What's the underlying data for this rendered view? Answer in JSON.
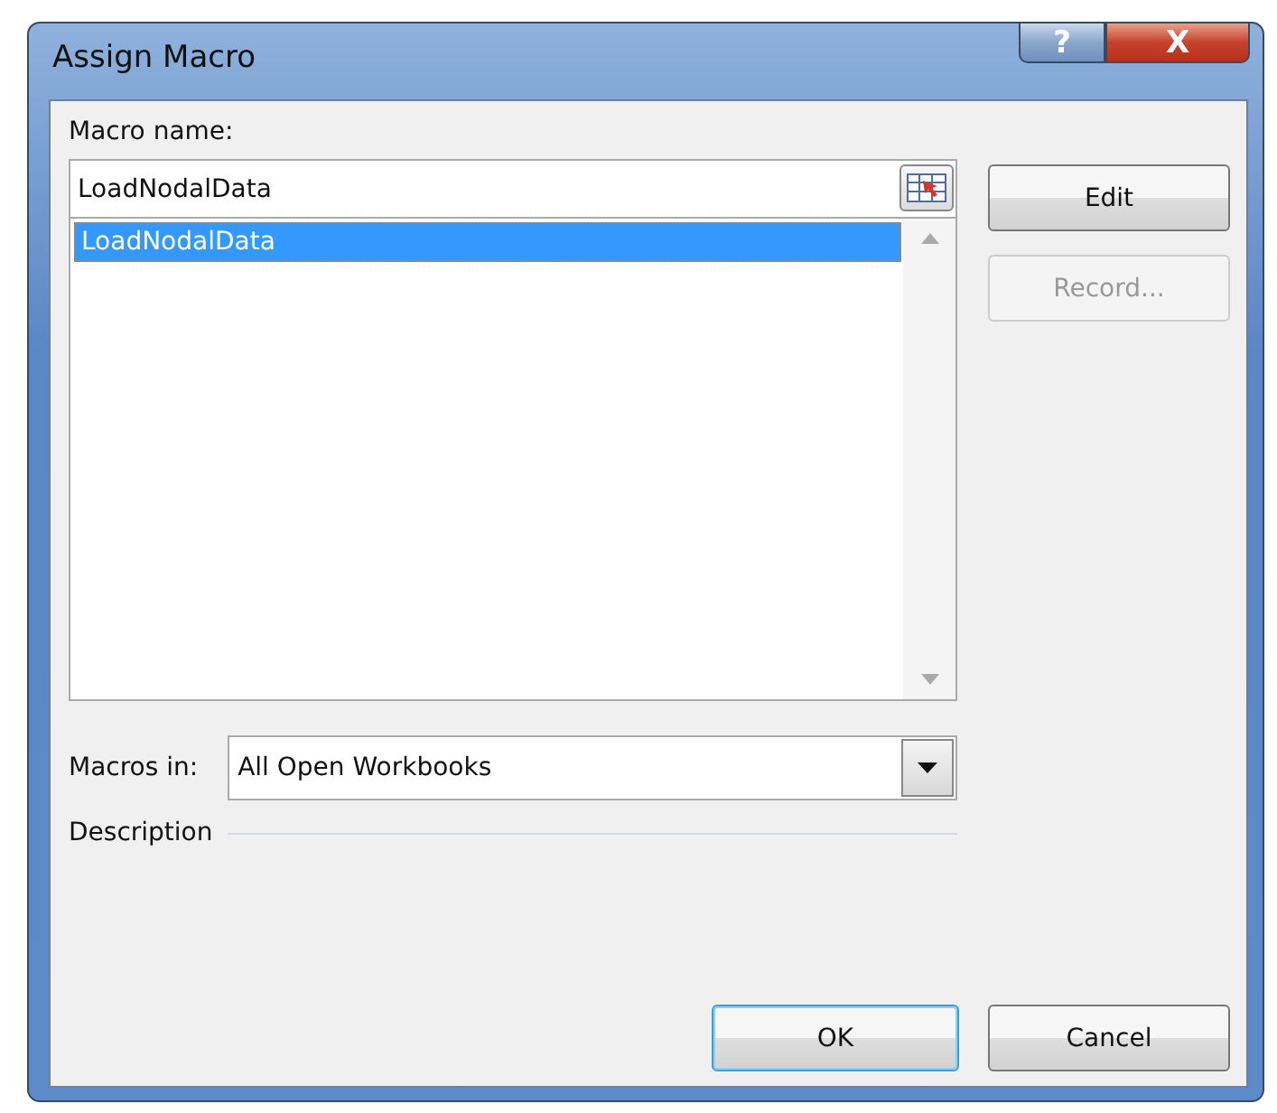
{
  "window": {
    "title": "Assign Macro",
    "help_button": "?",
    "close_button": "X"
  },
  "macro_name": {
    "label": "Macro name:",
    "value": "LoadNodalData"
  },
  "macro_list": [
    {
      "name": "LoadNodalData",
      "selected": true
    }
  ],
  "macros_in": {
    "label": "Macros in:",
    "value": "All Open Workbooks"
  },
  "description": {
    "label": "Description"
  },
  "side_buttons": [
    {
      "label": "Edit",
      "disabled": false
    },
    {
      "label": "Record...",
      "disabled": true
    }
  ],
  "footer_buttons": [
    {
      "label": "OK",
      "default": true
    },
    {
      "label": "Cancel",
      "default": false
    }
  ]
}
